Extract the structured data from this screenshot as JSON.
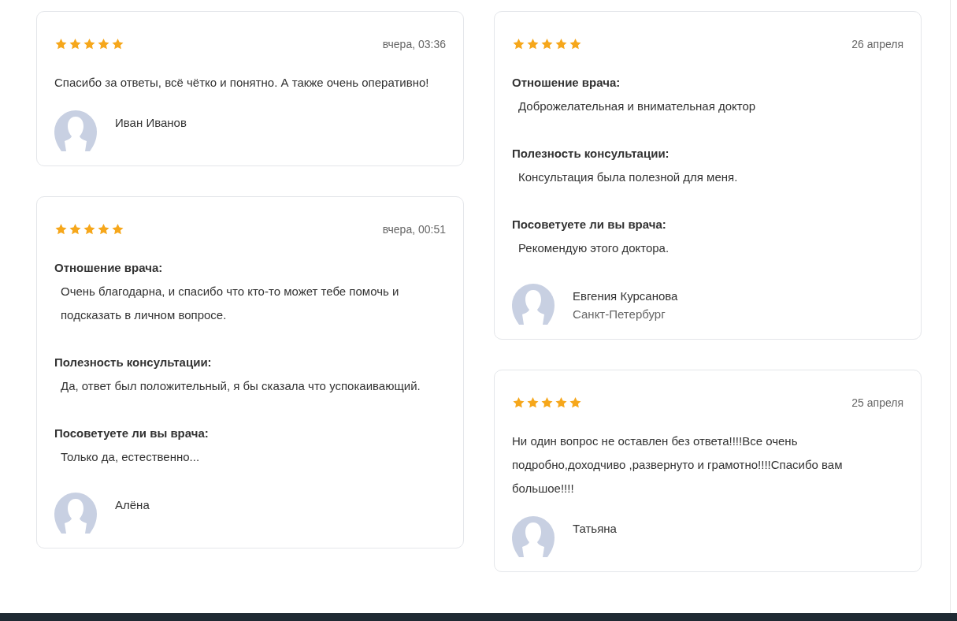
{
  "columns": [
    {
      "reviews": [
        {
          "stars": 5,
          "date": "вчера, 03:36",
          "kind": "text",
          "text": "Спасибо за ответы, всё чётко и понятно. А также очень оперативно!",
          "author": "Иван Иванов"
        },
        {
          "stars": 5,
          "date": "вчера, 00:51",
          "kind": "sections",
          "sections": [
            {
              "heading": "Отношение врача:",
              "answer": "Очень благодарна, и спасибо что кто-то может тебе помочь и подсказать в личном вопросе."
            },
            {
              "heading": "Полезность консультации:",
              "answer": "Да, ответ был положительный, я бы сказала что успокаивающий."
            },
            {
              "heading": "Посоветуете ли вы врача:",
              "answer": "Только да, естественно..."
            }
          ],
          "author": "Алёна"
        }
      ]
    },
    {
      "reviews": [
        {
          "stars": 5,
          "date": "26 апреля",
          "kind": "sections",
          "sections": [
            {
              "heading": "Отношение врача:",
              "answer": "Доброжелательная и внимательная доктор"
            },
            {
              "heading": "Полезность консультации:",
              "answer": "Консультация была полезной для меня."
            },
            {
              "heading": "Посоветуете ли вы врача:",
              "answer": "Рекомендую этого доктора."
            }
          ],
          "author": "Евгения Курсанова",
          "city": "Санкт-Петербург"
        },
        {
          "stars": 5,
          "date": "25 апреля",
          "kind": "text",
          "text": "Ни один вопрос не оставлен без ответа!!!!Все очень подробно,доходчиво ,развернуто и грамотно!!!!Спасибо вам большое!!!!",
          "author": "Татьяна"
        }
      ]
    }
  ]
}
